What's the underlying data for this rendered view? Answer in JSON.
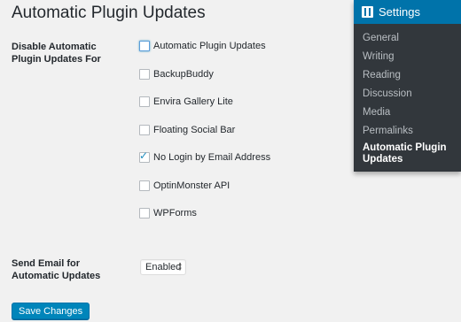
{
  "page": {
    "title": "Automatic Plugin Updates"
  },
  "disable_row": {
    "label": "Disable Automatic Plugin Updates For",
    "options": [
      {
        "label": "Automatic Plugin Updates",
        "checked": false,
        "focused": true
      },
      {
        "label": "BackupBuddy",
        "checked": false
      },
      {
        "label": "Envira Gallery Lite",
        "checked": false
      },
      {
        "label": "Floating Social Bar",
        "checked": false
      },
      {
        "label": "No Login by Email Address",
        "checked": true
      },
      {
        "label": "OptinMonster API",
        "checked": false
      },
      {
        "label": "WPForms",
        "checked": false
      }
    ]
  },
  "email_row": {
    "label": "Send Email for Automatic Updates",
    "selected": "Enabled"
  },
  "submit": {
    "label": "Save Changes"
  },
  "submenu": {
    "title": "Settings",
    "icon": "settings-sliders-icon",
    "items": [
      {
        "label": "General"
      },
      {
        "label": "Writing"
      },
      {
        "label": "Reading"
      },
      {
        "label": "Discussion"
      },
      {
        "label": "Media"
      },
      {
        "label": "Permalinks"
      },
      {
        "label": "Automatic Plugin Updates",
        "current": true
      }
    ]
  },
  "colors": {
    "primary": "#0085ba",
    "submenu_bg": "#32373c",
    "submenu_head": "#0073aa"
  }
}
